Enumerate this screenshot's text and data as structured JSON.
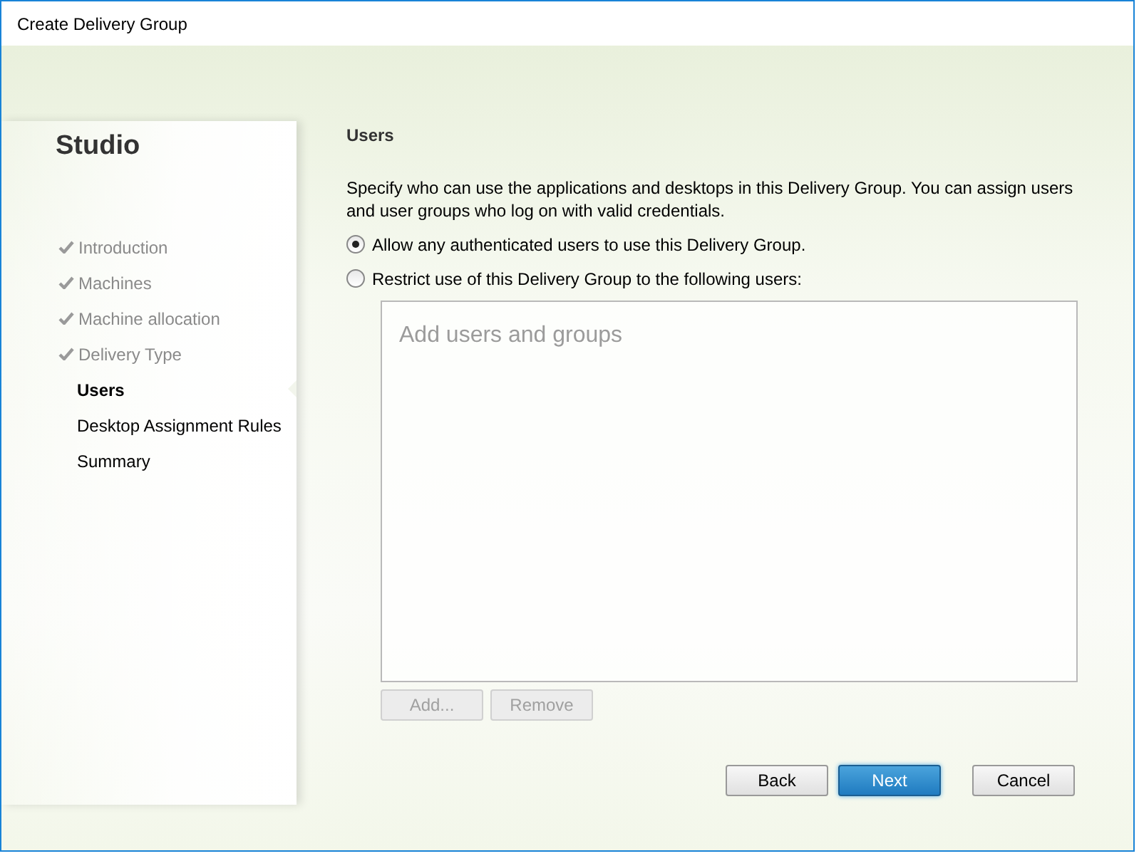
{
  "window": {
    "title": "Create Delivery Group"
  },
  "sidebar": {
    "heading": "Studio",
    "steps": [
      {
        "label": "Introduction",
        "completed": true,
        "selected": false
      },
      {
        "label": "Machines",
        "completed": true,
        "selected": false
      },
      {
        "label": "Machine allocation",
        "completed": true,
        "selected": false
      },
      {
        "label": "Delivery Type",
        "completed": true,
        "selected": false
      },
      {
        "label": "Users",
        "completed": false,
        "selected": true
      },
      {
        "label": "Desktop Assignment Rules",
        "completed": false,
        "selected": false
      },
      {
        "label": "Summary",
        "completed": false,
        "selected": false
      }
    ]
  },
  "page": {
    "heading": "Users",
    "description": "Specify who can use the applications and desktops in this Delivery Group. You can assign users and user groups who log on with valid credentials.",
    "options": [
      {
        "label": "Allow any authenticated users to use this Delivery Group.",
        "selected": true
      },
      {
        "label": "Restrict use of this Delivery Group to the following users:",
        "selected": false
      }
    ],
    "user_list": {
      "placeholder": "Add users and groups"
    },
    "list_buttons": [
      {
        "label": "Add...",
        "disabled": true
      },
      {
        "label": "Remove",
        "disabled": true
      }
    ]
  },
  "footer_buttons": [
    {
      "label": "Back",
      "kind": "normal"
    },
    {
      "label": "Next",
      "kind": "primary"
    },
    {
      "label": "Cancel",
      "kind": "normal"
    }
  ]
}
